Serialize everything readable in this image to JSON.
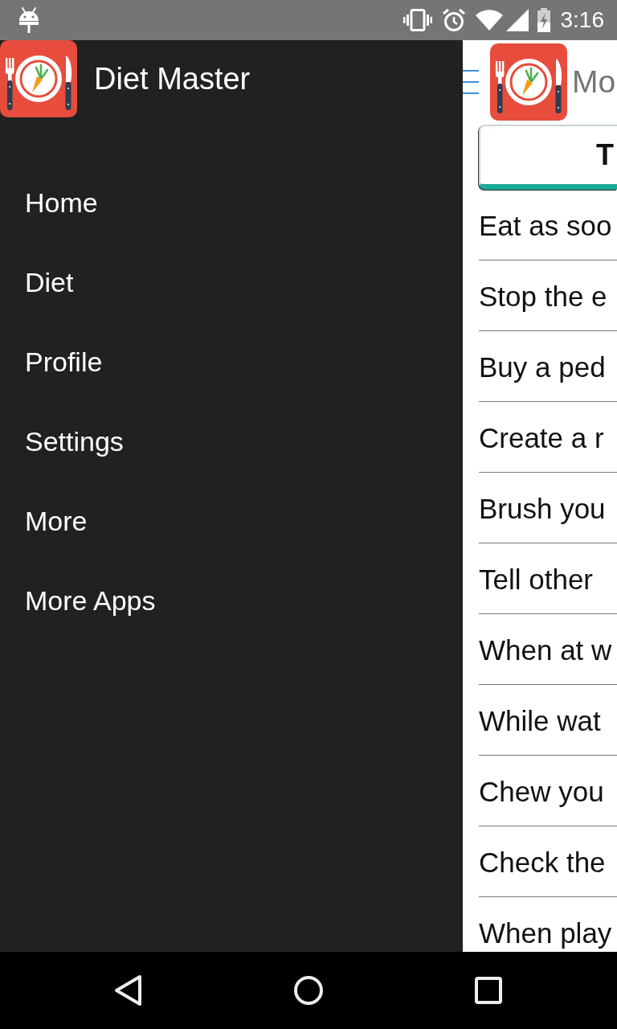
{
  "status_bar": {
    "time": "3:16"
  },
  "drawer": {
    "title": "Diet Master",
    "items": [
      {
        "label": "Home"
      },
      {
        "label": "Diet"
      },
      {
        "label": "Profile"
      },
      {
        "label": "Settings"
      },
      {
        "label": "More"
      },
      {
        "label": "More Apps"
      }
    ]
  },
  "app_bar": {
    "title": "Mo"
  },
  "content": {
    "button": {
      "label": "T"
    },
    "tips": [
      "Eat as soo",
      "Stop the e",
      "Buy a ped",
      "Create a r",
      "Brush you",
      "Tell other",
      "When at w",
      "While wat",
      "Chew you",
      "Check the",
      "When play"
    ]
  }
}
